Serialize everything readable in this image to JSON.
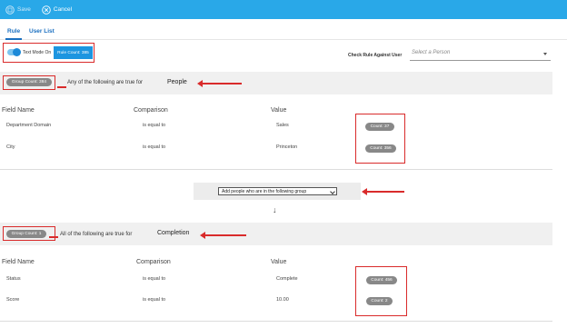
{
  "toolbar": {
    "save_label": "Save",
    "cancel_label": "Cancel"
  },
  "tabs": [
    {
      "label": "Rule",
      "active": true
    },
    {
      "label": "User List",
      "active": false
    }
  ],
  "mode": {
    "toggle_label": "Text Mode On",
    "rule_count": "Rule Count: 385"
  },
  "check": {
    "label": "Check Rule Against User",
    "placeholder": "Select a Person"
  },
  "columns": {
    "field": "Field Name",
    "comparison": "Comparison",
    "value": "Value"
  },
  "group1": {
    "count": "Group Count: 384",
    "any_text": "Any of the following are true for",
    "entity": "People",
    "rows": [
      {
        "field": "Department Domain",
        "comparison": "is equal to",
        "value": "Sales",
        "count": "Count: 37"
      },
      {
        "field": "City",
        "comparison": "is equal to",
        "value": "Princeton",
        "count": "Count: 356"
      }
    ]
  },
  "join": {
    "option": "Add people who are in the following group"
  },
  "group2": {
    "count": "Group Count: 1",
    "all_text": "All of the following are true for",
    "entity": "Completion",
    "rows": [
      {
        "field": "Status",
        "comparison": "is equal to",
        "value": "Complete",
        "count": "Count: 456"
      },
      {
        "field": "Score",
        "comparison": "is equal to",
        "value": "10.00",
        "count": "Count: 2"
      }
    ]
  },
  "colors": {
    "topbar": "#29a8e8",
    "accent": "#1a6fc0",
    "annotation": "#d92b2b",
    "badge": "#888888"
  }
}
